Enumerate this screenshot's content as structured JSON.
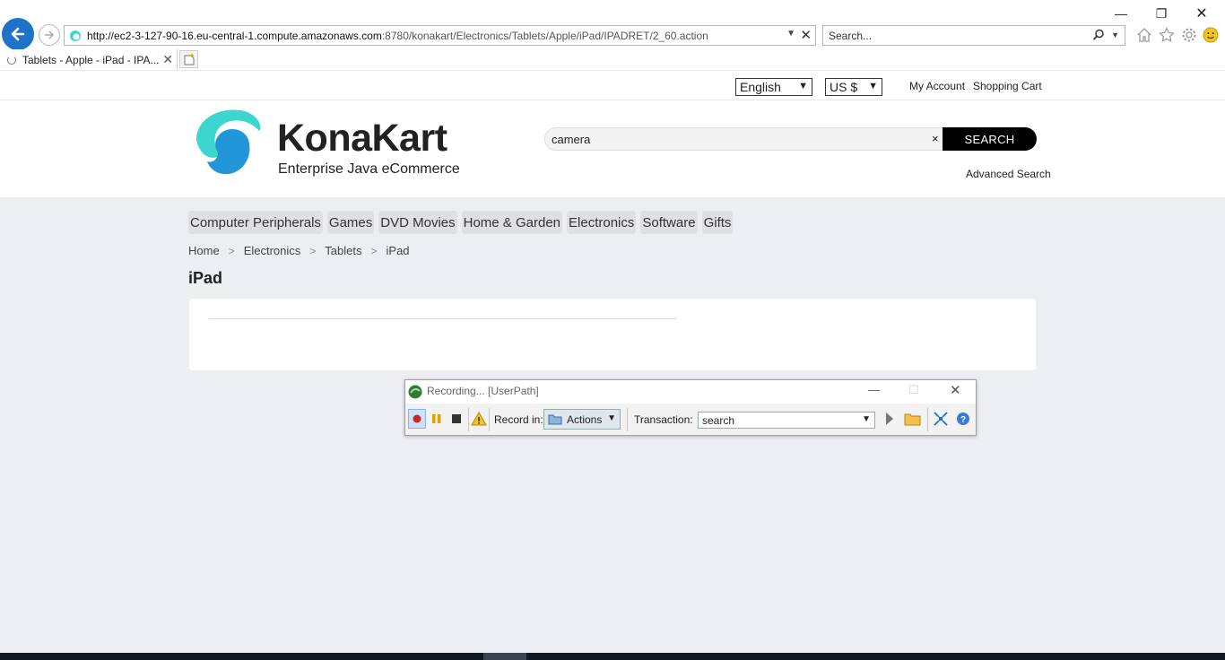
{
  "browser": {
    "url_host": "http://ec2-3-127-90-16.eu-central-1.compute.amazonaws.com",
    "url_rest": ":8780/konakart/Electronics/Tablets/Apple/iPad/IPADRET/2_60.action",
    "search_placeholder": "Search...",
    "tab_title": "Tablets - Apple - iPad - IPA...",
    "window_controls": {
      "minimize": "—",
      "restore": "❐",
      "close": "✕"
    }
  },
  "topbar": {
    "language": "English",
    "currency": "US $",
    "my_account": "My Account",
    "shopping_cart": "Shopping Cart"
  },
  "header": {
    "brand": "KonaKart",
    "tagline": "Enterprise Java eCommerce",
    "search_value": "camera",
    "search_clear": "×",
    "search_button": "SEARCH",
    "advanced_search": "Advanced Search",
    "logo_colors": {
      "light": "#3dd6cf",
      "dark": "#2196d8"
    }
  },
  "categories": [
    "Computer Peripherals",
    "Games",
    "DVD Movies",
    "Home & Garden",
    "Electronics",
    "Software",
    "Gifts"
  ],
  "breadcrumb": [
    "Home",
    "Electronics",
    "Tablets",
    "iPad"
  ],
  "page_title": "iPad",
  "recorder": {
    "title": "Recording... [UserPath]",
    "record_in_label": "Record in:",
    "record_in_value": "Actions",
    "transaction_label": "Transaction:",
    "transaction_value": "search"
  },
  "colors": {
    "accent": "#1e73c8",
    "page_bg": "#edeef1",
    "search_button_bg": "#000000"
  }
}
